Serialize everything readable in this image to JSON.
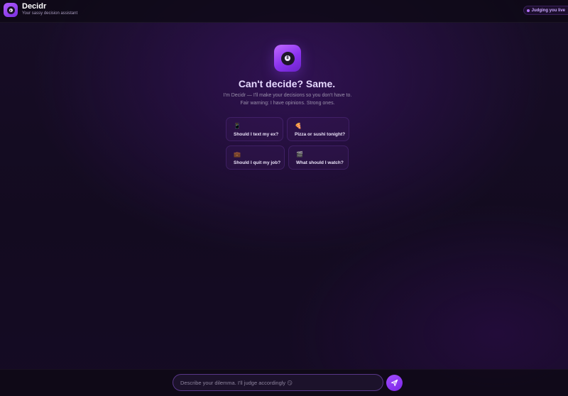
{
  "header": {
    "app_name": "Decidr",
    "tagline": "Your sassy decision assistant",
    "status": "Judging you live",
    "logo_glyph": "8"
  },
  "hero": {
    "logo_glyph": "8",
    "title": "Can't decide? Same.",
    "description": "I'm Decidr — I'll make your decisions so you don't have to. Fair warning: I have opinions. Strong ones."
  },
  "suggestions": [
    {
      "icon": "phone-icon",
      "glyph": "📱",
      "label": "Should I text my ex?"
    },
    {
      "icon": "pizza-icon",
      "glyph": "🍕",
      "label": "Pizza or sushi tonight?"
    },
    {
      "icon": "briefcase-icon",
      "glyph": "💼",
      "label": "Should I quit my job?"
    },
    {
      "icon": "clapperboard-icon",
      "glyph": "🎬",
      "label": "What should I watch?"
    }
  ],
  "composer": {
    "placeholder": "Describe your dilemma. I'll judge accordingly 😏",
    "send_icon": "send-icon"
  },
  "colors": {
    "accent": "#9b45ff",
    "background": "#140b21"
  }
}
